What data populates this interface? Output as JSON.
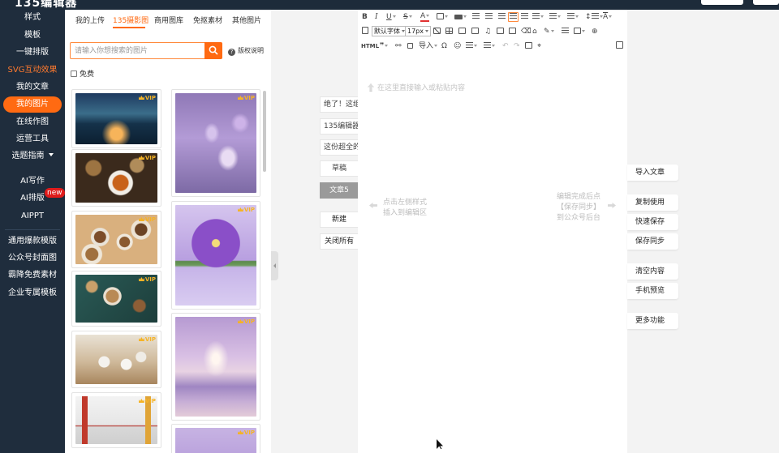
{
  "app": {
    "logo": "135编辑器"
  },
  "sidebar": {
    "items": [
      {
        "label": "样式"
      },
      {
        "label": "模板"
      },
      {
        "label": "一键排版"
      },
      {
        "label": "SVG互动效果"
      },
      {
        "label": "我的文章"
      },
      {
        "label": "我的图片"
      },
      {
        "label": "在线作图"
      },
      {
        "label": "运营工具"
      },
      {
        "label": "选题指南"
      },
      {
        "label": "AI写作"
      },
      {
        "label": "AI排版"
      },
      {
        "label": "AIPPT"
      },
      {
        "label": "通用爆款模版"
      },
      {
        "label": "公众号封面图"
      },
      {
        "label": "霸降免费素材"
      },
      {
        "label": "企业专属模板"
      }
    ],
    "new_badge": "new",
    "colors": {
      "bg": "#1f2d3d",
      "active": "#ff6a12",
      "highlight": "#ff7a2e"
    }
  },
  "image_panel": {
    "tabs": [
      {
        "label": "我的上传"
      },
      {
        "label": "135摄影图"
      },
      {
        "label": "商用图库"
      },
      {
        "label": "免抠素材"
      },
      {
        "label": "其他图片"
      }
    ],
    "active_tab": "135摄影图",
    "search": {
      "placeholder": "请输入你想搜索的图片",
      "value": ""
    },
    "copyright_label": "版权说明",
    "free_filter_label": "免费",
    "vip_label": "VIP"
  },
  "articles": {
    "items": [
      {
        "label": "绝了！这组"
      },
      {
        "label": "135编辑器"
      },
      {
        "label": "这份超全的"
      },
      {
        "label": "草稿"
      },
      {
        "label": "文章5"
      }
    ],
    "new_label": "新建",
    "close_all_label": "关闭所有"
  },
  "editor": {
    "toolbar": {
      "font_family": "默认字体",
      "font_size": "17px",
      "html_label": "HTML",
      "import_label": "导入"
    },
    "placeholder": "在这里直接输入或粘贴内容",
    "hint_left": [
      "点击左侧样式",
      "插入到编辑区"
    ],
    "hint_right": [
      "编辑完成后点",
      "【保存同步】",
      "到公众号后台"
    ]
  },
  "actions": [
    {
      "label": "导入文章"
    },
    {
      "label": "复制使用"
    },
    {
      "label": "快速保存"
    },
    {
      "label": "保存同步"
    },
    {
      "label": "清空内容"
    },
    {
      "label": "手机预览"
    },
    {
      "label": "更多功能"
    }
  ]
}
